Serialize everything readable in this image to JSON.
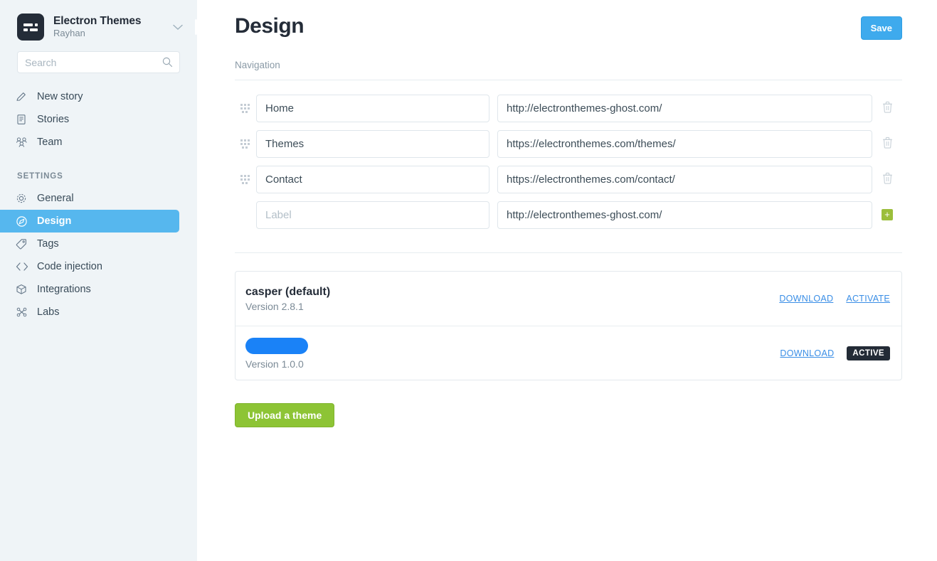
{
  "sidebar": {
    "brand": {
      "title": "Electron Themes",
      "subtitle": "Rayhan",
      "logo_icon": "list-logo-icon",
      "caret_icon": "chevron-down-icon"
    },
    "search": {
      "placeholder": "Search",
      "value": "",
      "icon": "search-icon"
    },
    "primary_items": [
      {
        "label": "New story",
        "icon": "pencil-icon"
      },
      {
        "label": "Stories",
        "icon": "document-icon"
      },
      {
        "label": "Team",
        "icon": "people-icon"
      }
    ],
    "settings_heading": "SETTINGS",
    "settings_items": [
      {
        "label": "General",
        "icon": "gear-icon",
        "active": false
      },
      {
        "label": "Design",
        "icon": "compass-icon",
        "active": true
      },
      {
        "label": "Tags",
        "icon": "tag-icon",
        "active": false
      },
      {
        "label": "Code injection",
        "icon": "code-icon",
        "active": false
      },
      {
        "label": "Integrations",
        "icon": "box-icon",
        "active": false
      },
      {
        "label": "Labs",
        "icon": "flask-icon",
        "active": false
      }
    ],
    "collapse_handle": "sidebar-collapse-handle"
  },
  "header": {
    "title": "Design",
    "save_label": "Save"
  },
  "navigation": {
    "section_label": "Navigation",
    "label_placeholder": "Label",
    "url_placeholder": "http://electronthemes-ghost.com/",
    "rows": [
      {
        "label": "Home",
        "url": "http://electronthemes-ghost.com/",
        "label_is_placeholder": false,
        "action": "delete"
      },
      {
        "label": "Themes",
        "url": "https://electronthemes.com/themes/",
        "label_is_placeholder": false,
        "action": "delete"
      },
      {
        "label": "Contact",
        "url": "https://electronthemes.com/contact/",
        "label_is_placeholder": false,
        "action": "delete"
      },
      {
        "label": "",
        "url": "http://electronthemes-ghost.com/",
        "label_is_placeholder": true,
        "action": "add"
      }
    ],
    "delete_icon": "trash-icon",
    "add_icon": "plus-icon",
    "drag_icon": "drag-handle-icon"
  },
  "themes": {
    "rows": [
      {
        "name": "casper (default)",
        "name_redacted": false,
        "version": "Version 2.8.1",
        "download_label": "DOWNLOAD",
        "secondary_label": "ACTIVATE",
        "secondary_type": "link"
      },
      {
        "name": "",
        "name_redacted": true,
        "version": "Version 1.0.0",
        "download_label": "DOWNLOAD",
        "secondary_label": "ACTIVE",
        "secondary_type": "badge"
      }
    ],
    "upload_label": "Upload a theme"
  },
  "colors": {
    "accent_blue": "#3eaaed",
    "sidebar_bg": "#eff4f7",
    "active_nav": "#56b7ee",
    "upload_green": "#8dc435",
    "add_green": "#9bbe3b",
    "redaction_blue": "#1a82f7",
    "badge_dark": "#232b36"
  }
}
